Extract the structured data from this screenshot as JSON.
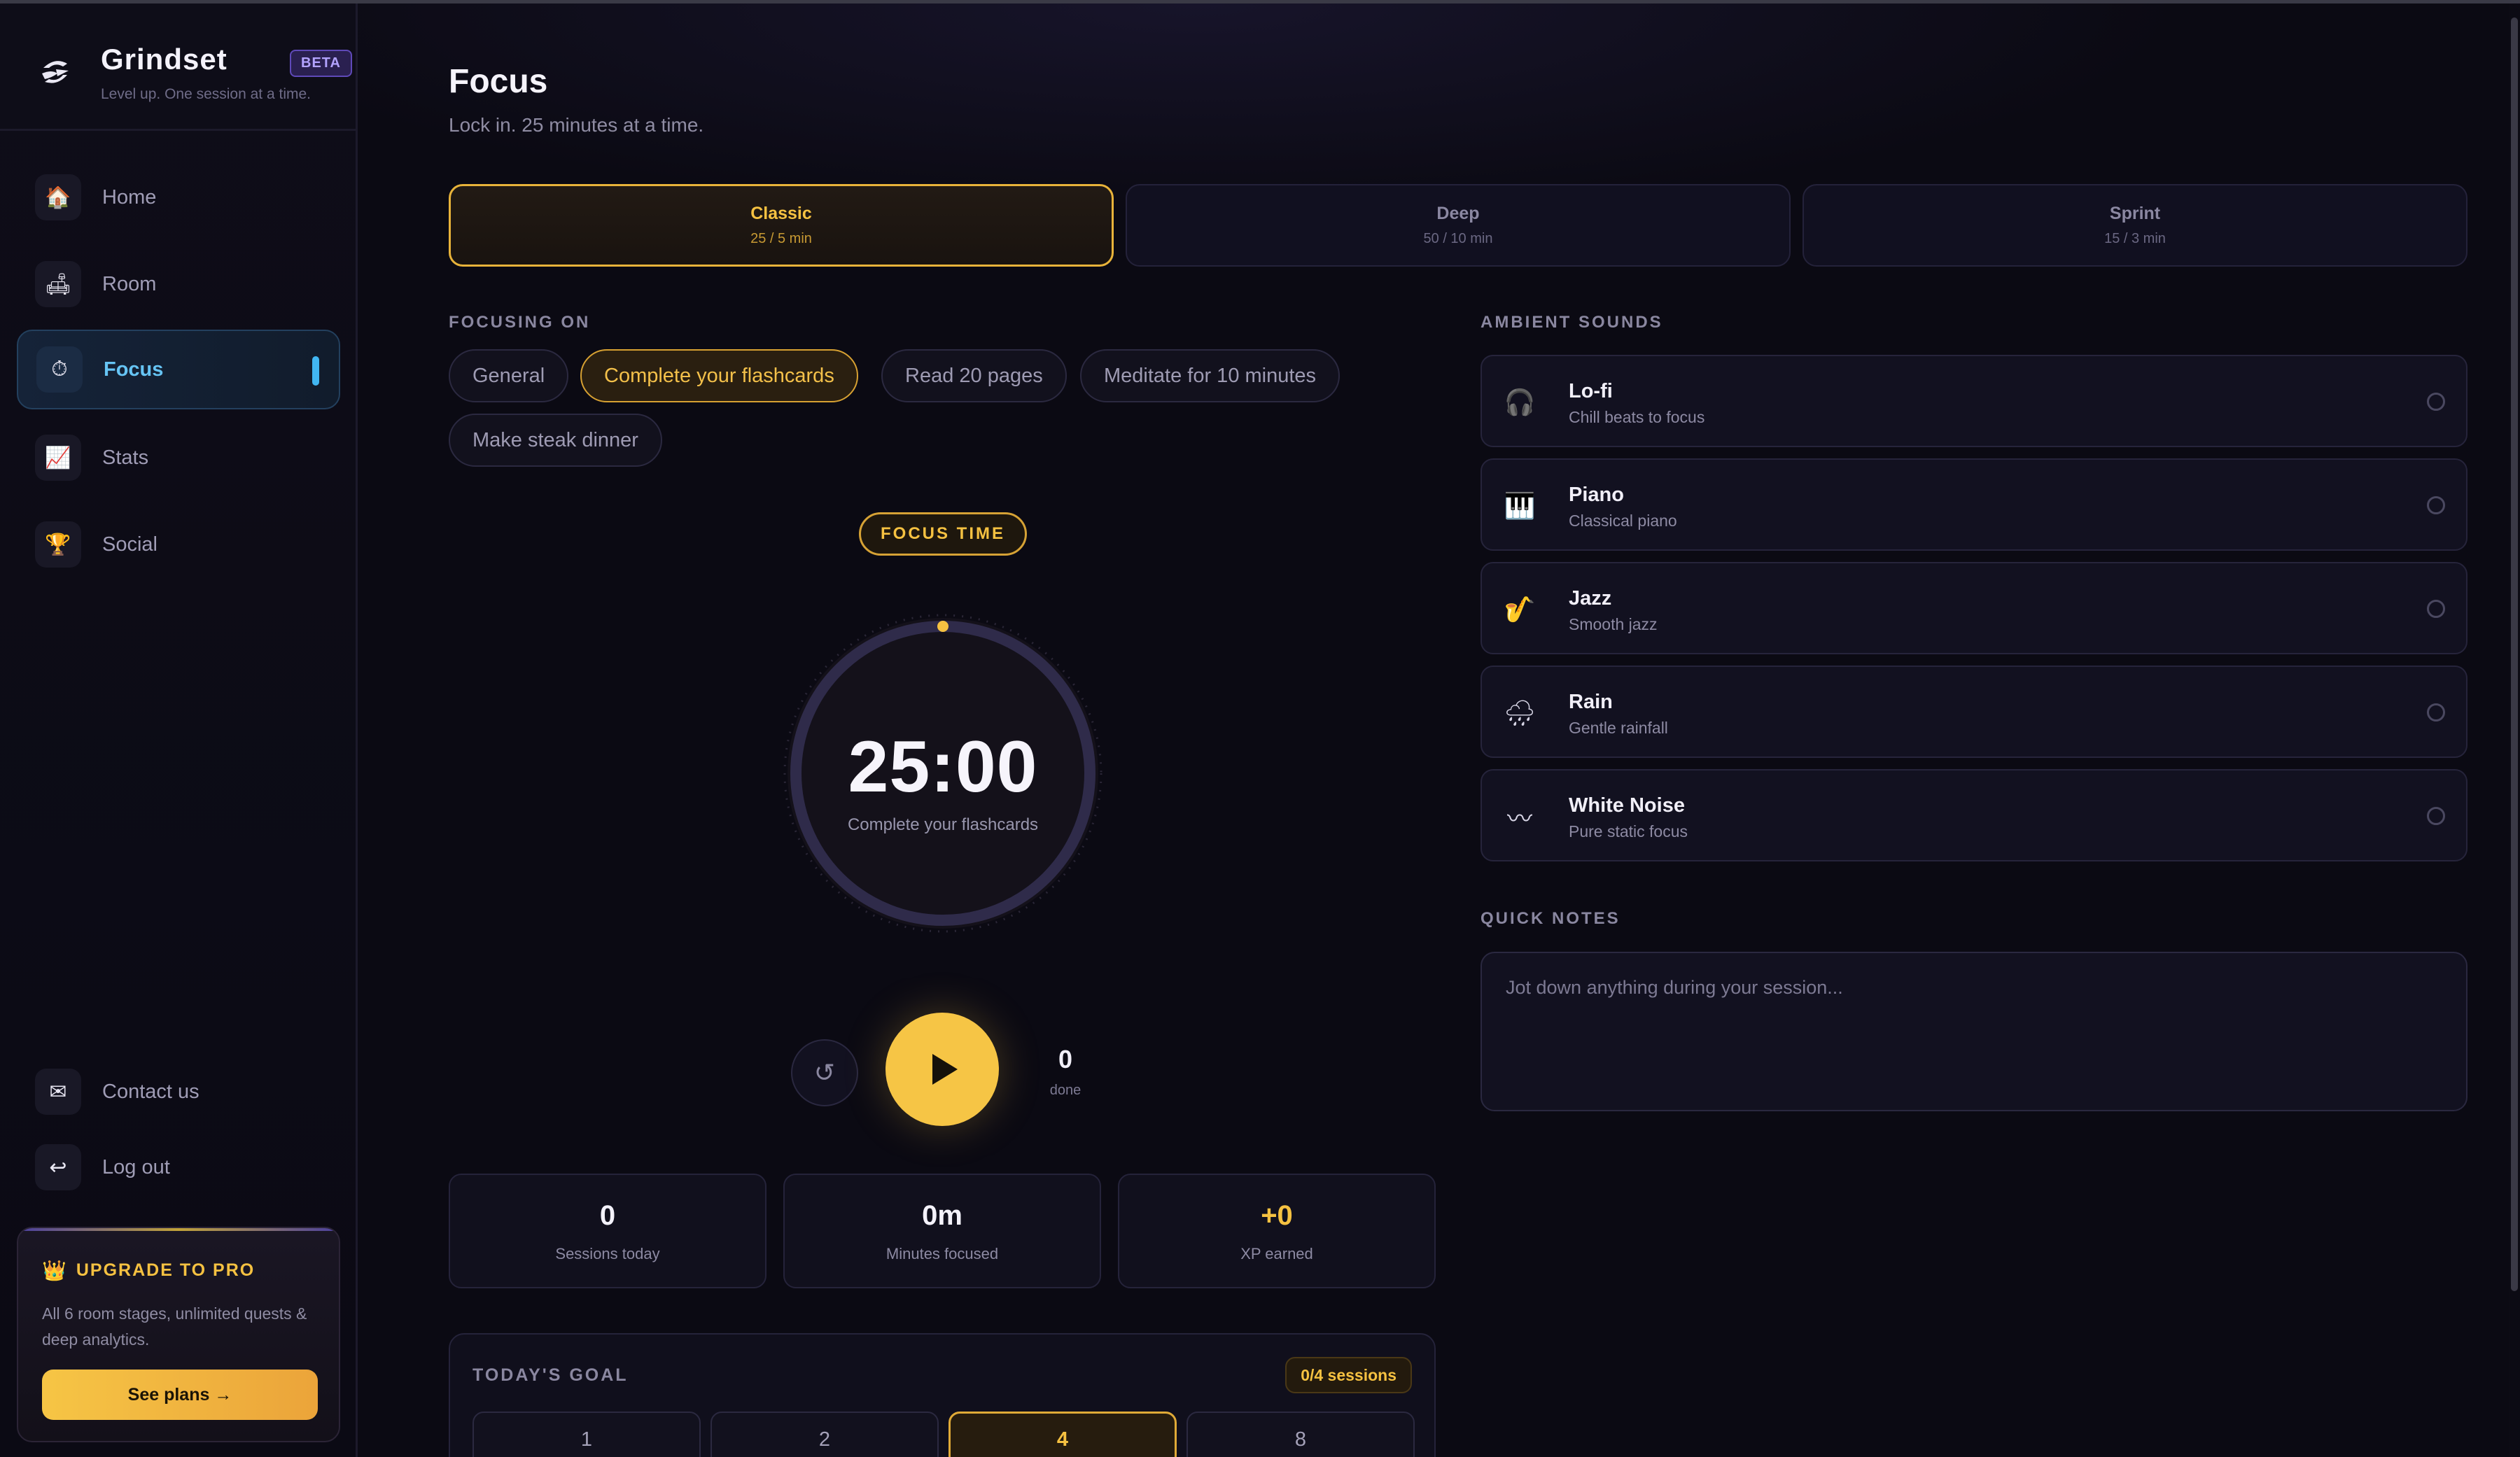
{
  "brand": {
    "name": "Grindset",
    "badge": "BETA",
    "tagline": "Level up. One session at a time."
  },
  "sidebar": {
    "items": [
      {
        "label": "Home",
        "icon": "🏠",
        "icon_name": "house-icon"
      },
      {
        "label": "Room",
        "icon": "🛋",
        "icon_name": "couch-icon"
      },
      {
        "label": "Focus",
        "icon": "⏱",
        "icon_name": "stopwatch-icon",
        "active": true
      },
      {
        "label": "Stats",
        "icon": "📈",
        "icon_name": "chart-icon"
      },
      {
        "label": "Social",
        "icon": "🏆",
        "icon_name": "trophy-icon"
      }
    ],
    "bottom_items": [
      {
        "label": "Contact us",
        "icon": "✉",
        "icon_name": "envelope-icon"
      },
      {
        "label": "Log out",
        "icon": "↩",
        "icon_name": "logout-icon"
      }
    ],
    "upgrade": {
      "icon": "👑",
      "title": "UPGRADE TO PRO",
      "description": "All 6 room stages, unlimited quests & deep analytics.",
      "button": "See plans →"
    }
  },
  "page": {
    "title": "Focus",
    "subtitle": "Lock in. 25 minutes at a time."
  },
  "modes": [
    {
      "name": "Classic",
      "sub": "25 / 5 min",
      "active": true
    },
    {
      "name": "Deep",
      "sub": "50 / 10 min"
    },
    {
      "name": "Sprint",
      "sub": "15 / 3 min"
    }
  ],
  "focusing_on": {
    "label": "FOCUSING ON",
    "chips": [
      "General",
      "Complete your flashcards",
      "Read 20 pages",
      "Meditate for 10 minutes",
      "Make steak dinner"
    ],
    "active_index": 1
  },
  "timer": {
    "badge": "FOCUS TIME",
    "time": "25:00",
    "task": "Complete your flashcards",
    "reset_icon": "↺",
    "done_count": "0",
    "done_label": "done",
    "progress": 0
  },
  "stats": [
    {
      "value": "0",
      "label": "Sessions today"
    },
    {
      "value": "0m",
      "label": "Minutes focused"
    },
    {
      "value": "+0",
      "label": "XP earned"
    }
  ],
  "goal": {
    "title": "TODAY'S GOAL",
    "badge": "0/4 sessions",
    "options": [
      "1",
      "2",
      "4",
      "8"
    ],
    "active_index": 2
  },
  "ambient": {
    "label": "AMBIENT SOUNDS",
    "sounds": [
      {
        "name": "Lo-fi",
        "desc": "Chill beats to focus",
        "icon": "🎧",
        "icon_name": "headphones-icon"
      },
      {
        "name": "Piano",
        "desc": "Classical piano",
        "icon": "🎹",
        "icon_name": "piano-icon"
      },
      {
        "name": "Jazz",
        "desc": "Smooth jazz",
        "icon": "🎷",
        "icon_name": "saxophone-icon"
      },
      {
        "name": "Rain",
        "desc": "Gentle rainfall",
        "icon": "🌧",
        "icon_name": "rain-cloud-icon"
      },
      {
        "name": "White Noise",
        "desc": "Pure static focus",
        "icon": "〰",
        "icon_name": "waveform-icon"
      }
    ]
  },
  "notes": {
    "label": "QUICK NOTES",
    "placeholder": "Jot down anything during your session..."
  },
  "colors": {
    "accent_gold": "#f5c141",
    "accent_blue": "#66c4f4",
    "background": "#0b0a13"
  }
}
